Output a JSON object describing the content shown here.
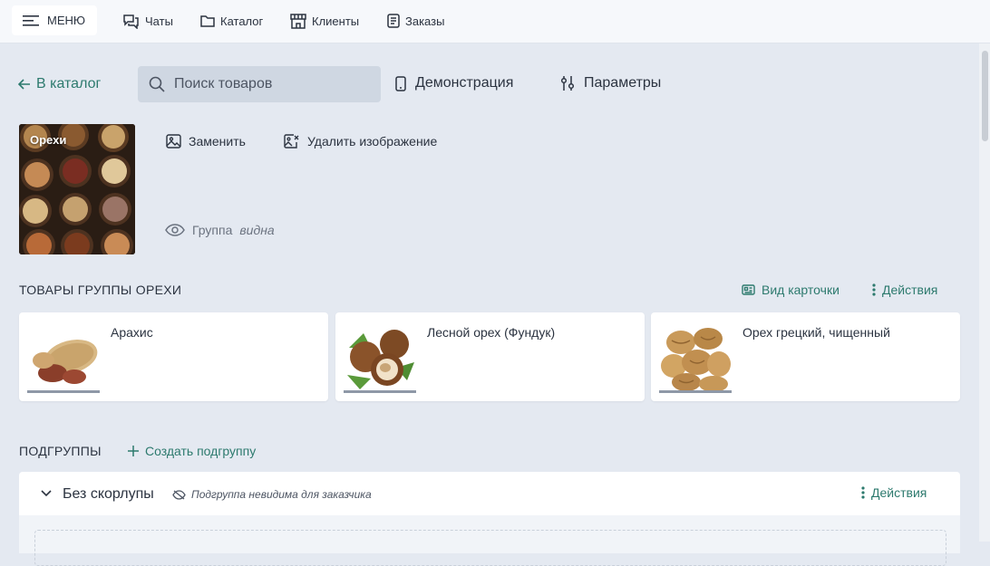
{
  "topbar": {
    "menu_label": "МЕНЮ",
    "nav": [
      {
        "label": "Чаты",
        "icon": "chat-icon"
      },
      {
        "label": "Каталог",
        "icon": "folder-icon"
      },
      {
        "label": "Клиенты",
        "icon": "store-icon"
      },
      {
        "label": "Заказы",
        "icon": "document-icon"
      }
    ]
  },
  "toolbar": {
    "back_label": "В каталог",
    "search_placeholder": "Поиск товаров",
    "demo_label": "Демонстрация",
    "params_label": "Параметры"
  },
  "group": {
    "image_label": "Орехи",
    "replace_label": "Заменить",
    "delete_image_label": "Удалить изображение",
    "visibility_label": "Группа",
    "visibility_state": "видна"
  },
  "products_section": {
    "title": "ТОВАРЫ ГРУППЫ ОРЕХИ",
    "card_view_label": "Вид карточки",
    "actions_label": "Действия",
    "items": [
      {
        "name": "Арахис",
        "image": "peanut-image"
      },
      {
        "name": "Лесной орех (Фундук)",
        "image": "hazelnut-image"
      },
      {
        "name": "Орех грецкий, чищенный",
        "image": "walnut-image"
      }
    ]
  },
  "subgroups_section": {
    "title": "ПОДГРУППЫ",
    "create_label": "Создать подгруппу",
    "items": [
      {
        "name": "Без скорлупы",
        "visibility_note": "Подгруппа невидима для заказчика",
        "actions_label": "Действия"
      }
    ]
  },
  "colors": {
    "accent": "#2d7a6e",
    "background": "#e4e9f1",
    "search_bg": "#cfd7e2"
  }
}
